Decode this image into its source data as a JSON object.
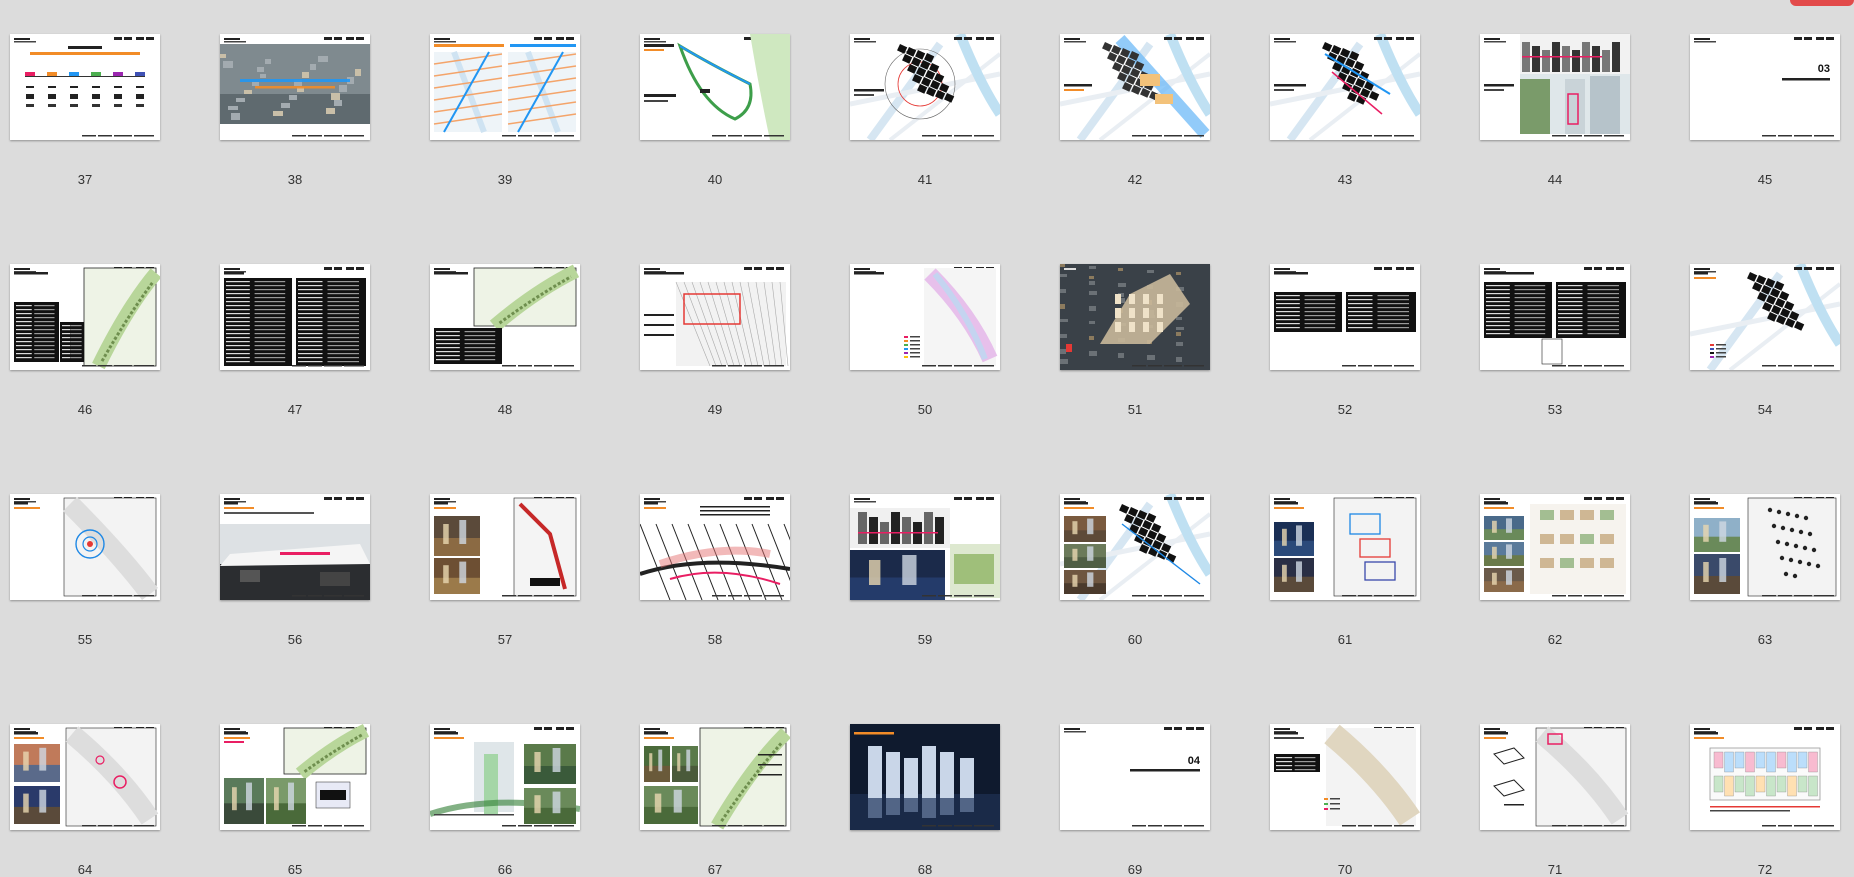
{
  "window": {
    "accent": "#e24a4a"
  },
  "slides": [
    {
      "number": "37",
      "type": "title-chart"
    },
    {
      "number": "38",
      "type": "aerial-photo"
    },
    {
      "number": "39",
      "type": "two-maps"
    },
    {
      "number": "40",
      "type": "map-green-loop"
    },
    {
      "number": "41",
      "type": "map-black-blocks"
    },
    {
      "number": "42",
      "type": "map-colorful-blocks"
    },
    {
      "number": "43",
      "type": "map-black-blocks-blue"
    },
    {
      "number": "44",
      "type": "buildings-render"
    },
    {
      "number": "45",
      "type": "section-03"
    },
    {
      "number": "46",
      "type": "table-map"
    },
    {
      "number": "47",
      "type": "table-full"
    },
    {
      "number": "48",
      "type": "table-map-small"
    },
    {
      "number": "49",
      "type": "plan-gray"
    },
    {
      "number": "50",
      "type": "plan-colored-right"
    },
    {
      "number": "51",
      "type": "aerial-night"
    },
    {
      "number": "52",
      "type": "two-tables"
    },
    {
      "number": "53",
      "type": "two-tables-dense"
    },
    {
      "number": "54",
      "type": "map-black-blocks-legend"
    },
    {
      "number": "55",
      "type": "map-circle"
    },
    {
      "number": "56",
      "type": "interior-render"
    },
    {
      "number": "57",
      "type": "photo-plan"
    },
    {
      "number": "58",
      "type": "street-plan"
    },
    {
      "number": "59",
      "type": "renders-mix"
    },
    {
      "number": "60",
      "type": "photos-black-blocks"
    },
    {
      "number": "61",
      "type": "photos-plan-color"
    },
    {
      "number": "62",
      "type": "photos-sketch"
    },
    {
      "number": "63",
      "type": "photos-dots"
    },
    {
      "number": "64",
      "type": "photos-plan-pink"
    },
    {
      "number": "65",
      "type": "plan-photos-bottom"
    },
    {
      "number": "66",
      "type": "section-green"
    },
    {
      "number": "67",
      "type": "photos-plan-green"
    },
    {
      "number": "68",
      "type": "night-towers"
    },
    {
      "number": "69",
      "type": "section-04"
    },
    {
      "number": "70",
      "type": "plan-table"
    },
    {
      "number": "71",
      "type": "plan-isometric"
    },
    {
      "number": "72",
      "type": "floor-plan"
    }
  ],
  "texts": {
    "section_03_number": "03",
    "section_04_number": "04"
  }
}
